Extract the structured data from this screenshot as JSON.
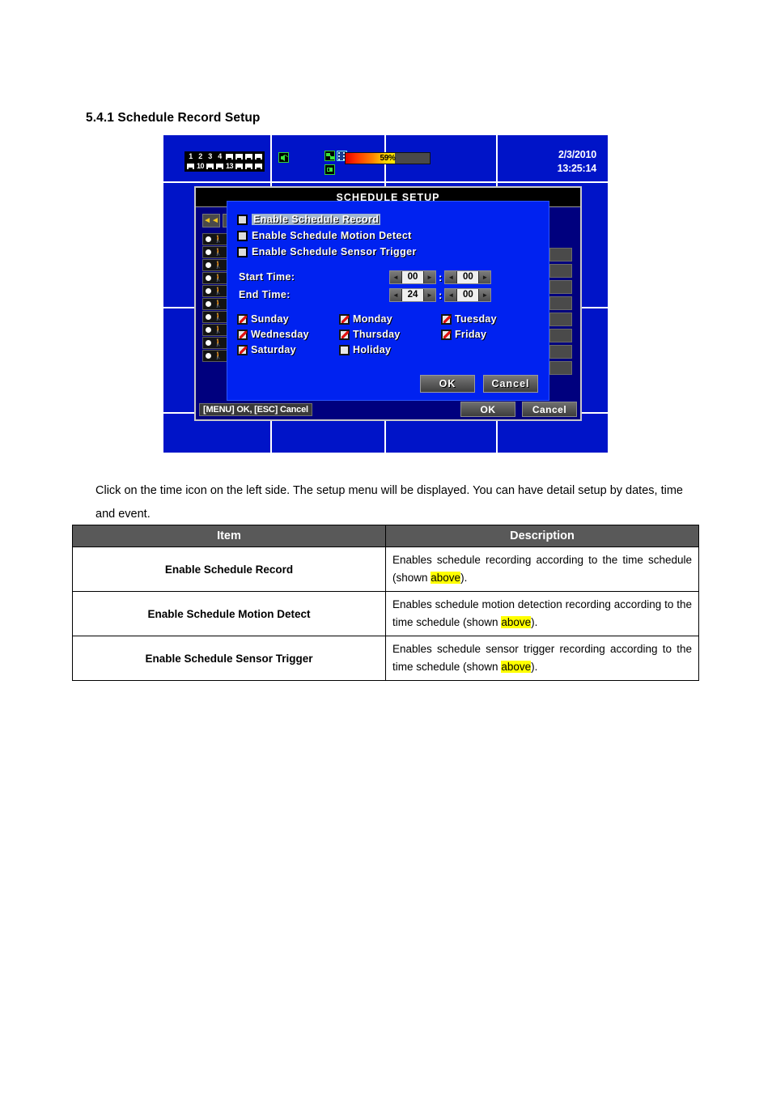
{
  "document": {
    "heading": "5.4.1 Schedule Record Setup",
    "paragraph": "Click on the time icon on the left side. The setup menu will be displayed. You can have detail setup by dates, time and event."
  },
  "dvr": {
    "statusbar": {
      "channels_row1": [
        "1",
        "2",
        "3",
        "4",
        "",
        "",
        "",
        ""
      ],
      "channels_row2": [
        "",
        "10",
        "",
        "",
        "13",
        "",
        "",
        ""
      ],
      "progress_value": "59%",
      "progress_percent": 59,
      "date": "2/3/2010",
      "time": "13:25:14",
      "icons": [
        "speaker-mute-icon",
        "network-icon",
        "film-icon",
        "hdd-icon"
      ]
    },
    "background_window": {
      "title": "SCHEDULE SETUP",
      "hint": "[MENU] OK, [ESC] Cancel",
      "ok_label": "OK",
      "cancel_label": "Cancel",
      "toolbar_icon": "◄◄"
    },
    "dialog": {
      "options": [
        {
          "label": "Enable Schedule Record",
          "checked": false,
          "highlighted": true
        },
        {
          "label": "Enable Schedule Motion Detect",
          "checked": false,
          "highlighted": false
        },
        {
          "label": "Enable Schedule Sensor Trigger",
          "checked": false,
          "highlighted": false
        }
      ],
      "start_time": {
        "label": "Start Time:",
        "hour": "00",
        "minute": "00"
      },
      "end_time": {
        "label": "End Time:",
        "hour": "24",
        "minute": "00"
      },
      "days": [
        {
          "label": "Sunday",
          "checked": true
        },
        {
          "label": "Monday",
          "checked": true
        },
        {
          "label": "Tuesday",
          "checked": true
        },
        {
          "label": "Wednesday",
          "checked": true
        },
        {
          "label": "Thursday",
          "checked": true
        },
        {
          "label": "Friday",
          "checked": true
        },
        {
          "label": "Saturday",
          "checked": true
        },
        {
          "label": "Holiday",
          "checked": false
        }
      ],
      "ok_label": "OK",
      "cancel_label": "Cancel",
      "left_arrow": "◄",
      "right_arrow": "►",
      "colon": ":"
    },
    "colors": {
      "screen_blue": "#0014c8",
      "dialog_blue": "#0022f0",
      "window_navy": "#00007e",
      "highlight": "#9fb4cf",
      "check_red": "#e01010"
    }
  },
  "table": {
    "headers": [
      "Item",
      "Description"
    ],
    "rows": [
      {
        "item": "Enable Schedule Record",
        "desc_pre": "Enables schedule recording according to the time schedule (shown ",
        "desc_hl": "above",
        "desc_post": ")."
      },
      {
        "item": "Enable Schedule Motion Detect",
        "desc_pre": "Enables schedule motion detection recording according to the time schedule (shown ",
        "desc_hl": "above",
        "desc_post": ")."
      },
      {
        "item": "Enable Schedule Sensor Trigger",
        "desc_pre": "Enables schedule sensor trigger recording according to the time schedule (shown ",
        "desc_hl": "above",
        "desc_post": ")."
      }
    ]
  }
}
